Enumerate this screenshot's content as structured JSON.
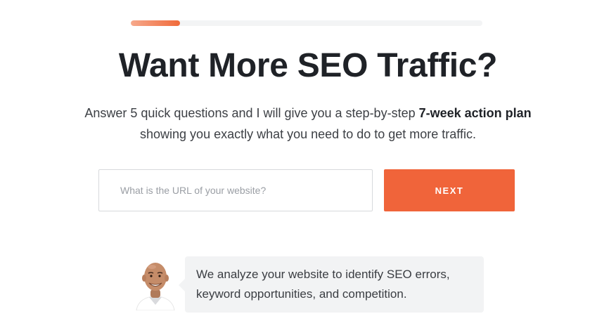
{
  "progress": {
    "value": 0.14
  },
  "hero": {
    "title": "Want More SEO Traffic?",
    "subtitle_before": "Answer 5 quick questions and I will give you a step-by-step ",
    "subtitle_bold": "7-week action plan",
    "subtitle_after": "showing you exactly what you need to do to get more traffic."
  },
  "form": {
    "url_placeholder": "What is the URL of your website?",
    "url_value": "",
    "next_label": "NEXT"
  },
  "testimonial": {
    "text": "We analyze your website to identify SEO errors, keyword opportunities, and competition."
  },
  "colors": {
    "accent": "#f0643a",
    "progress_track": "#f3f4f5",
    "bubble_bg": "#f2f3f4"
  }
}
